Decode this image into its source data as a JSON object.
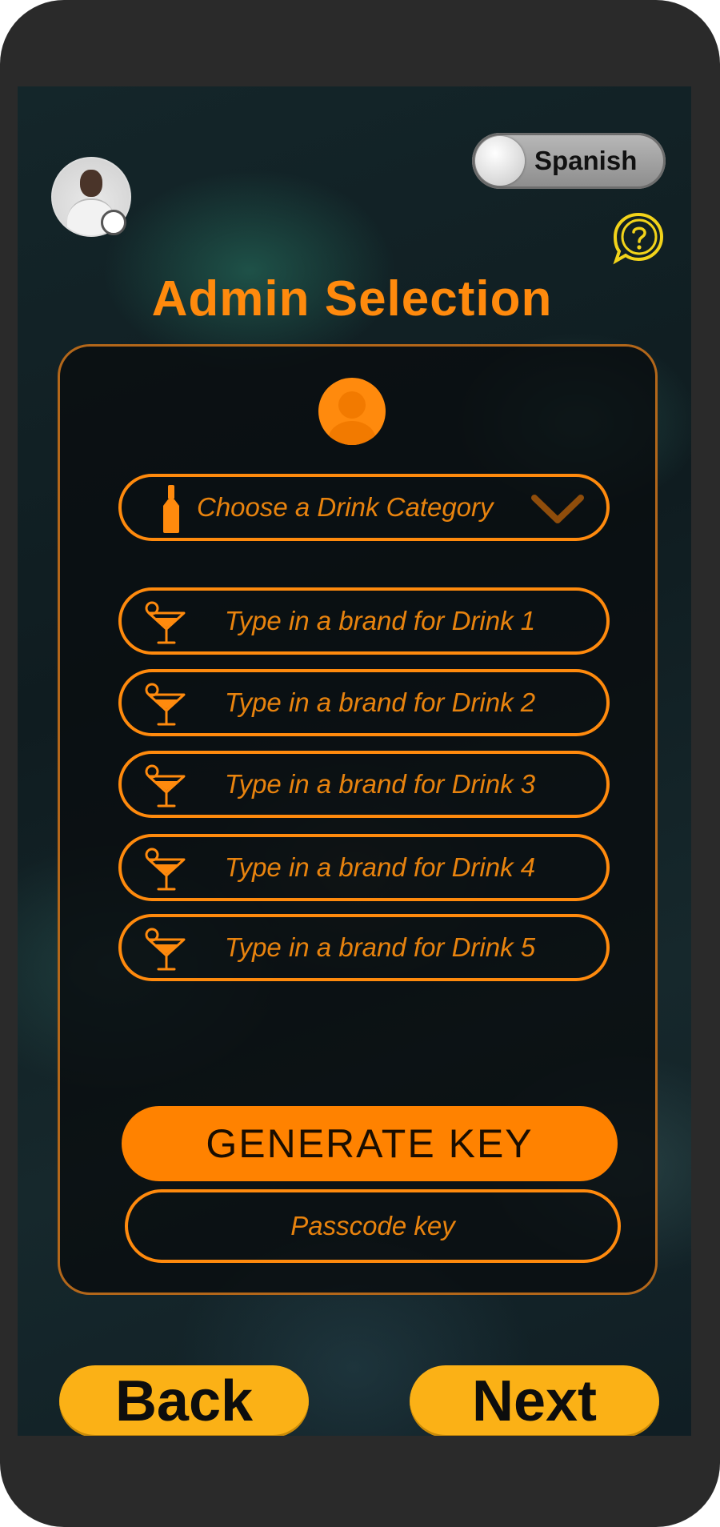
{
  "header": {
    "language_toggle_label": "Spanish",
    "title": "Admin Selection"
  },
  "form": {
    "category_placeholder": "Choose a Drink Category",
    "brand_placeholders": [
      "Type in a brand for Drink 1",
      "Type in a brand for Drink 2",
      "Type in a brand for Drink 3",
      "Type in a brand for Drink 4",
      "Type in a brand for Drink 5"
    ],
    "generate_label": "GENERATE KEY",
    "passcode_placeholder": "Passcode key"
  },
  "nav": {
    "back_label": "Back",
    "next_label": "Next"
  },
  "colors": {
    "accent": "#ff8a0d",
    "button_orange": "#ff8200",
    "nav_yellow": "#fbb116",
    "help_yellow": "#f2d31a"
  }
}
